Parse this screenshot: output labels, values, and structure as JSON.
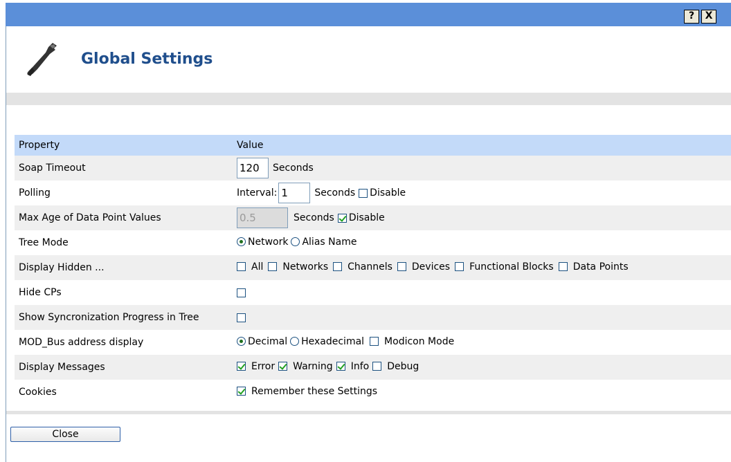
{
  "titlebar": {
    "help_label": "?",
    "close_label": "X"
  },
  "header": {
    "title": "Global Settings",
    "icon": "wrench-icon"
  },
  "table": {
    "col_property": "Property",
    "col_value": "Value",
    "soap": {
      "label": "Soap Timeout",
      "value": "120",
      "unit": "Seconds"
    },
    "polling": {
      "label": "Polling",
      "prefix": "Interval:",
      "value": "1",
      "unit": "Seconds",
      "disable_label": "Disable",
      "disable_checked": false
    },
    "maxage": {
      "label": "Max Age of Data Point Values",
      "value": "0.5",
      "unit": "Seconds",
      "disable_label": "Disable",
      "disable_checked": true
    },
    "tree": {
      "label": "Tree Mode",
      "options": [
        "Network",
        "Alias Name"
      ],
      "selected": "Network"
    },
    "hidden": {
      "label": "Display Hidden ...",
      "options": [
        "All",
        "Networks",
        "Channels",
        "Devices",
        "Functional Blocks",
        "Data Points"
      ]
    },
    "hidecps": {
      "label": "Hide CPs",
      "checked": false
    },
    "sync": {
      "label": "Show Syncronization Progress in Tree",
      "checked": false
    },
    "modbus": {
      "label": "MOD_Bus address display",
      "options": [
        "Decimal",
        "Hexadecimal"
      ],
      "selected": "Decimal",
      "modicon_label": "Modicon Mode",
      "modicon_checked": false
    },
    "messages": {
      "label": "Display Messages",
      "options": [
        {
          "label": "Error",
          "checked": true
        },
        {
          "label": "Warning",
          "checked": true
        },
        {
          "label": "Info",
          "checked": true
        },
        {
          "label": "Debug",
          "checked": false
        }
      ]
    },
    "cookies": {
      "label": "Cookies",
      "option_label": "Remember these Settings",
      "checked": true
    }
  },
  "footer": {
    "close_label": "Close"
  },
  "colors": {
    "titlebar": "#5b8fd9",
    "header_row": "#c3daf9",
    "alt_row": "#efefef",
    "title_text": "#1f4e8c"
  }
}
